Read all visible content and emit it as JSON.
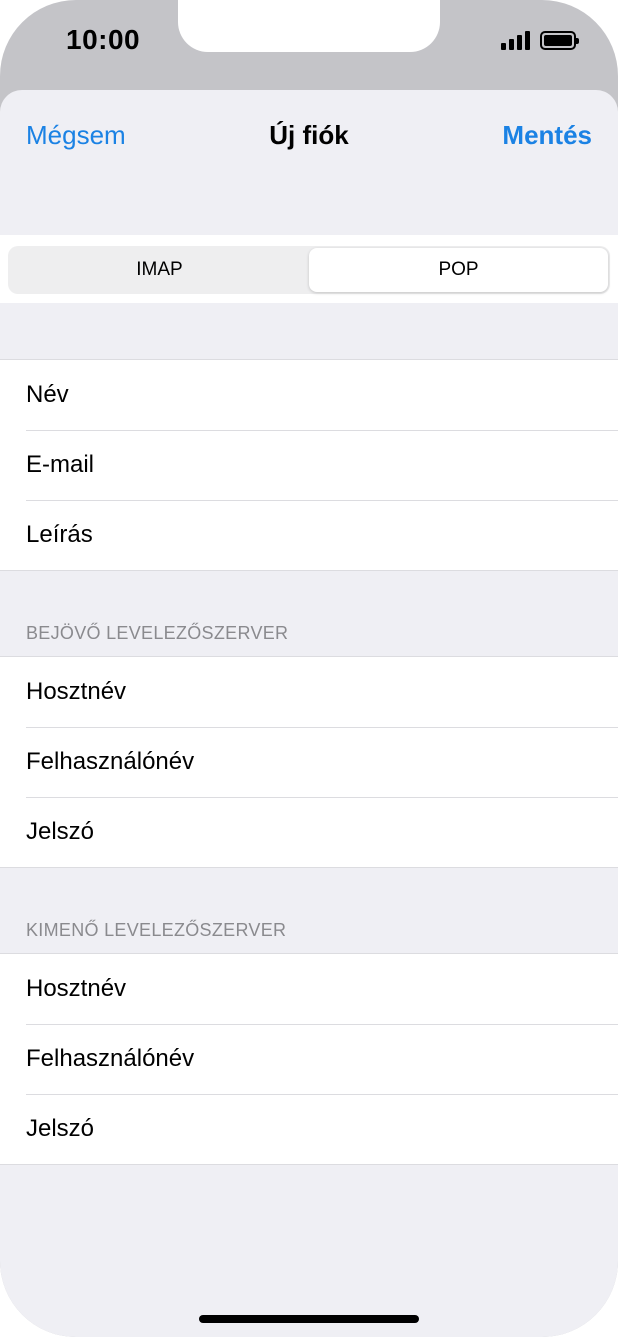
{
  "status_bar": {
    "time": "10:00",
    "signal_icon": "signal-icon",
    "battery_icon": "battery-icon"
  },
  "nav": {
    "cancel_label": "Mégsem",
    "title": "Új fiók",
    "save_label": "Mentés"
  },
  "segmented": {
    "options": [
      "IMAP",
      "POP"
    ],
    "selected": "POP"
  },
  "account_fields": [
    "Név",
    "E-mail",
    "Leírás"
  ],
  "incoming": {
    "header": "BEJÖVŐ LEVELEZŐSZERVER",
    "fields": [
      "Hosztnév",
      "Felhasználónév",
      "Jelszó"
    ]
  },
  "outgoing": {
    "header": "KIMENŐ LEVELEZŐSZERVER",
    "fields": [
      "Hosztnév",
      "Felhasználónév",
      "Jelszó"
    ]
  },
  "colors": {
    "accent": "#1b82e4",
    "background": "#efeff4",
    "section_header": "#8a8a8e"
  }
}
